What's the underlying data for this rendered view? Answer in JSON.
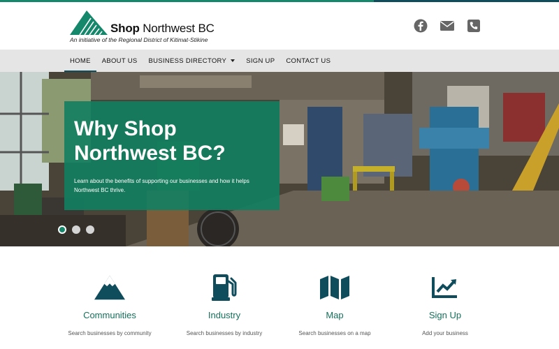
{
  "brand": {
    "name_bold": "Shop",
    "name_rest": " Northwest BC",
    "tagline": "An initiative of the Regional District of Kitimat-Stikine"
  },
  "social": {
    "facebook_icon": "facebook-icon",
    "email_icon": "envelope-icon",
    "phone_icon": "phone-icon"
  },
  "nav": {
    "items": [
      {
        "label": "HOME",
        "active": true
      },
      {
        "label": "ABOUT US"
      },
      {
        "label": "BUSINESS DIRECTORY",
        "dropdown": true
      },
      {
        "label": "SIGN UP"
      },
      {
        "label": "CONTACT US"
      }
    ]
  },
  "hero": {
    "heading_line1": "Why Shop",
    "heading_line2": "Northwest BC?",
    "text": "Learn about the benefits of supporting our businesses and how it helps Northwest BC thrive.",
    "slide_count": 3,
    "active_slide": 1
  },
  "features": [
    {
      "title": "Communities",
      "desc": "Search businesses by community",
      "icon": "mountain-icon"
    },
    {
      "title": "Industry",
      "desc": "Search businesses by industry",
      "icon": "gas-pump-icon"
    },
    {
      "title": "Map",
      "desc": "Search businesses on a map",
      "icon": "map-icon"
    },
    {
      "title": "Sign Up",
      "desc": "Add your business",
      "icon": "chart-line-icon"
    }
  ],
  "colors": {
    "brand_green": "#15876a",
    "brand_dark_teal": "#0f4c5c",
    "nav_bg": "#e5e5e5",
    "icon_color": "#0f4c5c",
    "social_icon_color": "#666666"
  }
}
